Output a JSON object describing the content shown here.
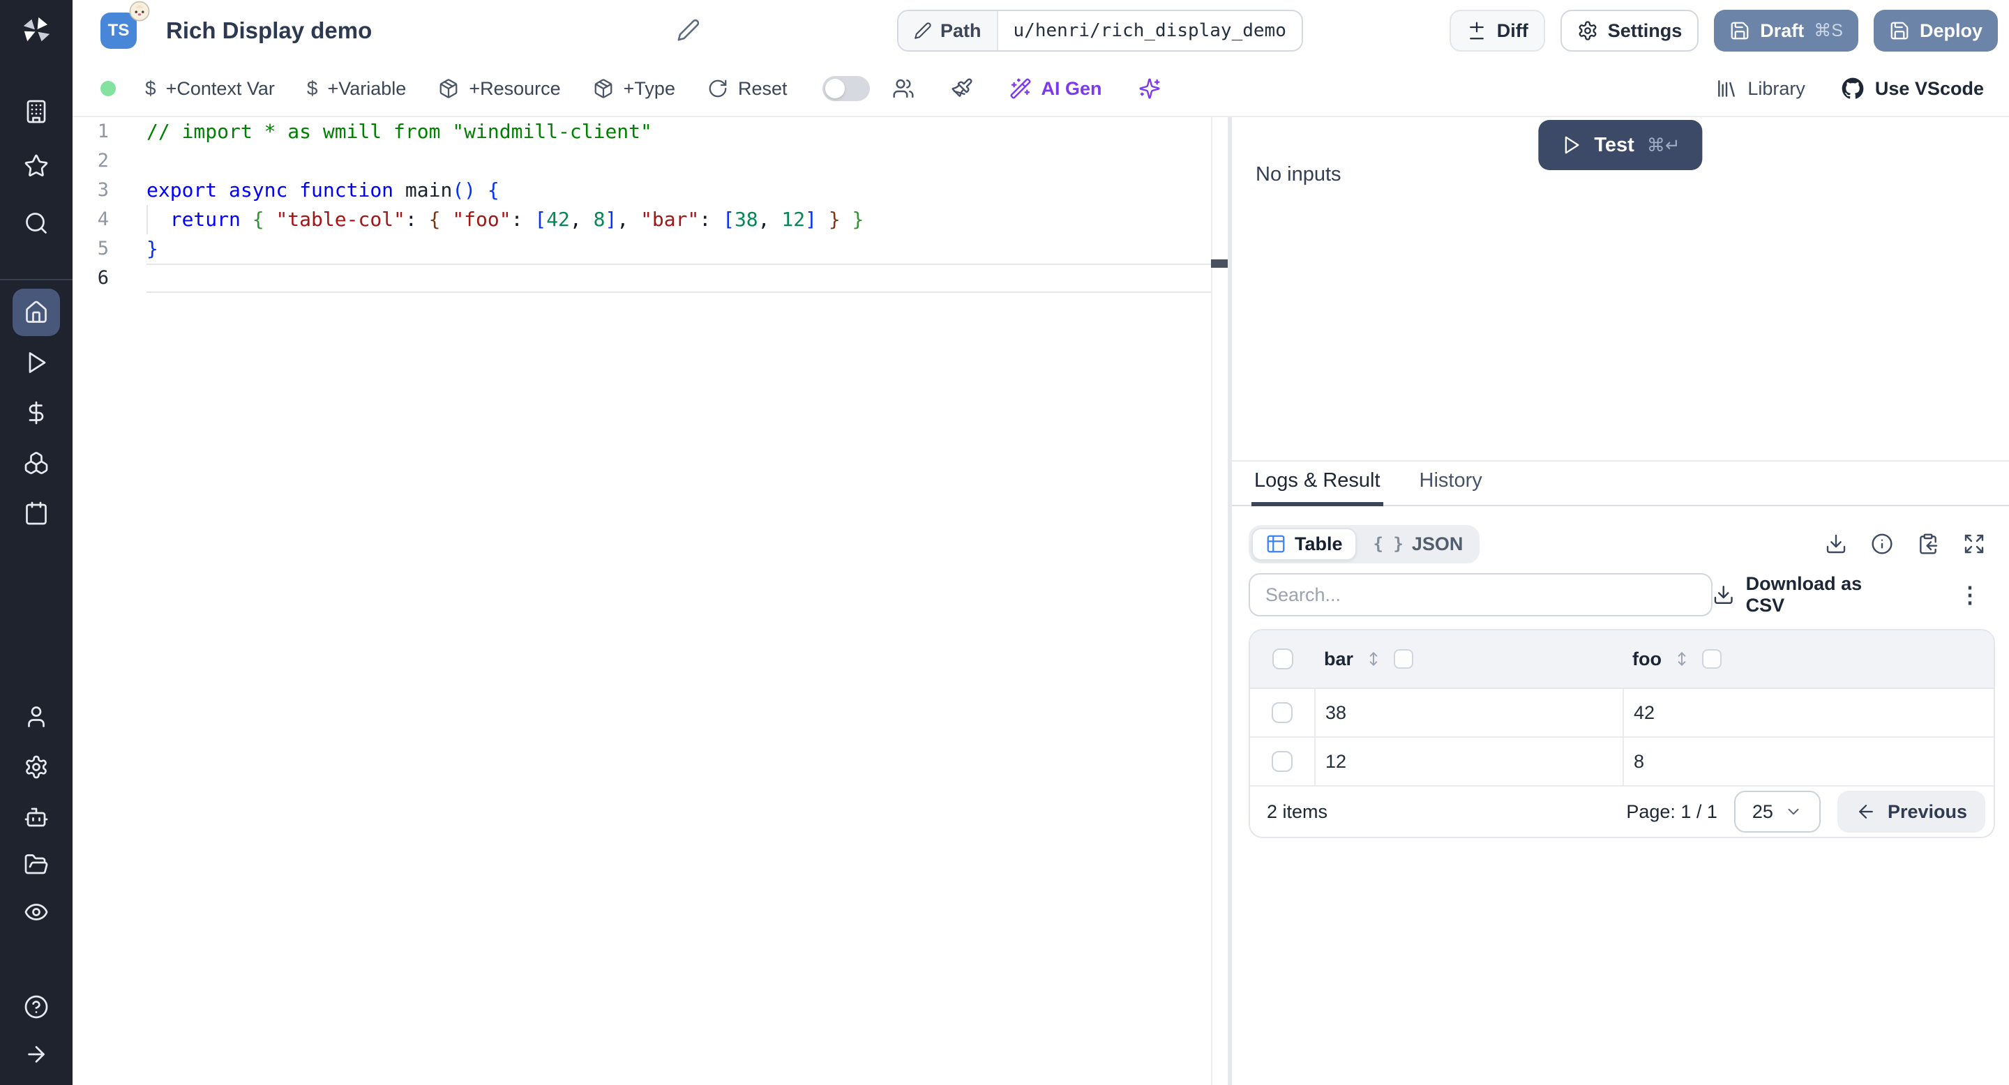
{
  "topbar": {
    "title": "Rich Display demo",
    "language_badge": "TS",
    "path_label": "Path",
    "path_value": "u/henri/rich_display_demo",
    "diff_label": "Diff",
    "settings_label": "Settings",
    "draft_label": "Draft",
    "draft_shortcut": "⌘S",
    "deploy_label": "Deploy"
  },
  "toolbar": {
    "context_var": "+Context Var",
    "variable": "+Variable",
    "resource": "+Resource",
    "type": "+Type",
    "reset": "Reset",
    "ai_gen": "AI Gen",
    "library": "Library",
    "use_vscode": "Use VScode"
  },
  "sidebar": {
    "items": [
      "building",
      "star",
      "search",
      "home",
      "play",
      "dollar",
      "boxes",
      "calendar",
      "user",
      "settings",
      "bot",
      "folder-open",
      "eye",
      "help",
      "arrow-right"
    ],
    "active": "home"
  },
  "editor": {
    "active_line": 6,
    "syntax_colors": {
      "comment": "#008000",
      "kw": "#0000ff",
      "str": "#a31515",
      "num": "#098658",
      "fn": "#1b222c",
      "b1": "#0431fa",
      "b2": "#319331",
      "b3": "#7b3814",
      "plain": "#111827"
    },
    "lines": [
      {
        "n": 1,
        "tokens": [
          {
            "t": "// import * as wmill from \"windmill-client\"",
            "c": "comment"
          }
        ]
      },
      {
        "n": 2,
        "tokens": []
      },
      {
        "n": 3,
        "tokens": [
          {
            "t": "export",
            "c": "kw"
          },
          {
            "t": " ",
            "c": "plain"
          },
          {
            "t": "async",
            "c": "kw"
          },
          {
            "t": " ",
            "c": "plain"
          },
          {
            "t": "function",
            "c": "kw"
          },
          {
            "t": " ",
            "c": "plain"
          },
          {
            "t": "main",
            "c": "fn"
          },
          {
            "t": "()",
            "c": "b1"
          },
          {
            "t": " ",
            "c": "plain"
          },
          {
            "t": "{",
            "c": "b1"
          }
        ]
      },
      {
        "n": 4,
        "tokens": [
          {
            "t": "  ",
            "c": "plain"
          },
          {
            "t": "return",
            "c": "kw"
          },
          {
            "t": " ",
            "c": "plain"
          },
          {
            "t": "{",
            "c": "b2"
          },
          {
            "t": " ",
            "c": "plain"
          },
          {
            "t": "\"table-col\"",
            "c": "str"
          },
          {
            "t": ": ",
            "c": "plain"
          },
          {
            "t": "{",
            "c": "b3"
          },
          {
            "t": " ",
            "c": "plain"
          },
          {
            "t": "\"foo\"",
            "c": "str"
          },
          {
            "t": ": ",
            "c": "plain"
          },
          {
            "t": "[",
            "c": "b1"
          },
          {
            "t": "42",
            "c": "num"
          },
          {
            "t": ", ",
            "c": "plain"
          },
          {
            "t": "8",
            "c": "num"
          },
          {
            "t": "]",
            "c": "b1"
          },
          {
            "t": ", ",
            "c": "plain"
          },
          {
            "t": "\"bar\"",
            "c": "str"
          },
          {
            "t": ": ",
            "c": "plain"
          },
          {
            "t": "[",
            "c": "b1"
          },
          {
            "t": "38",
            "c": "num"
          },
          {
            "t": ", ",
            "c": "plain"
          },
          {
            "t": "12",
            "c": "num"
          },
          {
            "t": "]",
            "c": "b1"
          },
          {
            "t": " ",
            "c": "plain"
          },
          {
            "t": "}",
            "c": "b3"
          },
          {
            "t": " ",
            "c": "plain"
          },
          {
            "t": "}",
            "c": "b2"
          }
        ]
      },
      {
        "n": 5,
        "tokens": [
          {
            "t": "}",
            "c": "b1"
          }
        ]
      },
      {
        "n": 6,
        "tokens": []
      }
    ]
  },
  "runner": {
    "test_label": "Test",
    "test_shortcut": "⌘↵",
    "no_inputs": "No inputs"
  },
  "result_panel": {
    "tabs": [
      {
        "label": "Logs & Result",
        "active": true
      },
      {
        "label": "History",
        "active": false
      }
    ],
    "view_toggle": {
      "table": "Table",
      "json": "JSON"
    },
    "search_placeholder": "Search...",
    "download_csv": "Download as CSV",
    "table": {
      "columns": [
        "bar",
        "foo"
      ],
      "rows": [
        [
          "38",
          "42"
        ],
        [
          "12",
          "8"
        ]
      ]
    },
    "footer": {
      "items_count": "2 items",
      "page": "Page: 1 / 1",
      "page_size": "25",
      "previous": "Previous"
    }
  },
  "icons": {
    "kebab": "⋮",
    "braces": "{ }",
    "dollar": "$"
  },
  "colors": {
    "sidebar_bg": "#1f232d",
    "primary_button": "#6b84a8",
    "test_button": "#3c4a68",
    "accent_purple": "#7c3aed",
    "status_green": "#83e29f",
    "table_icon_blue": "#3b82f6",
    "ts_badge_blue": "#4887d8",
    "active_nav_bg": "#47587a"
  }
}
